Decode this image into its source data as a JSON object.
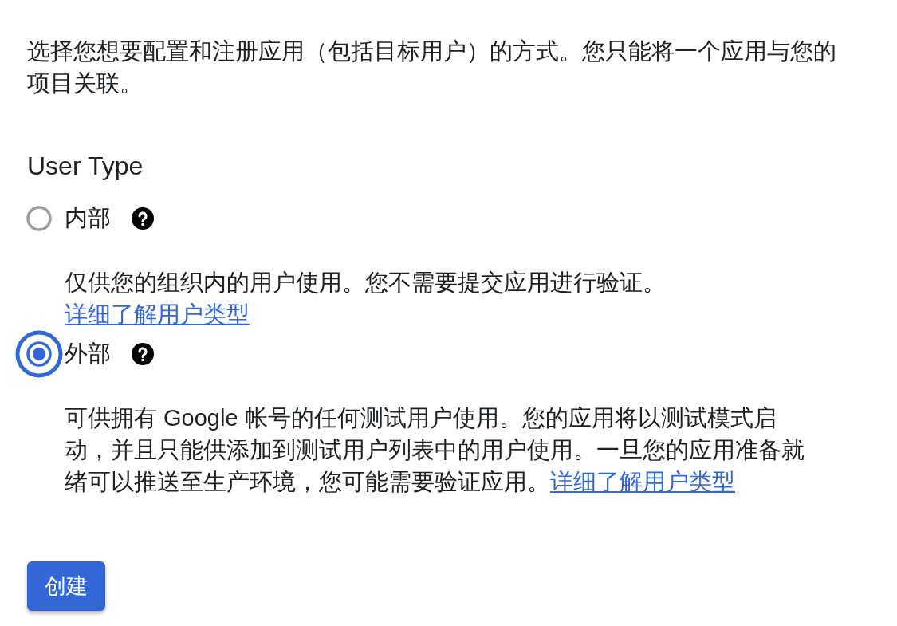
{
  "intro": "选择您想要配置和注册应用（包括目标用户）的方式。您只能将一个应用与您的项目关联。",
  "section_title": "User Type",
  "options": [
    {
      "label": "内部",
      "selected": false,
      "focused": false,
      "description": "仅供您的组织内的用户使用。您不需要提交应用进行验证。",
      "link": "详细了解用户类型"
    },
    {
      "label": "外部",
      "selected": true,
      "focused": true,
      "description": "可供拥有 Google 帐号的任何测试用户使用。您的应用将以测试模式启动，并且只能供添加到测试用户列表中的用户使用。一旦您的应用准备就绪可以推送至生产环境，您可能需要验证应用。",
      "link": "详细了解用户类型"
    }
  ],
  "button": "创建"
}
